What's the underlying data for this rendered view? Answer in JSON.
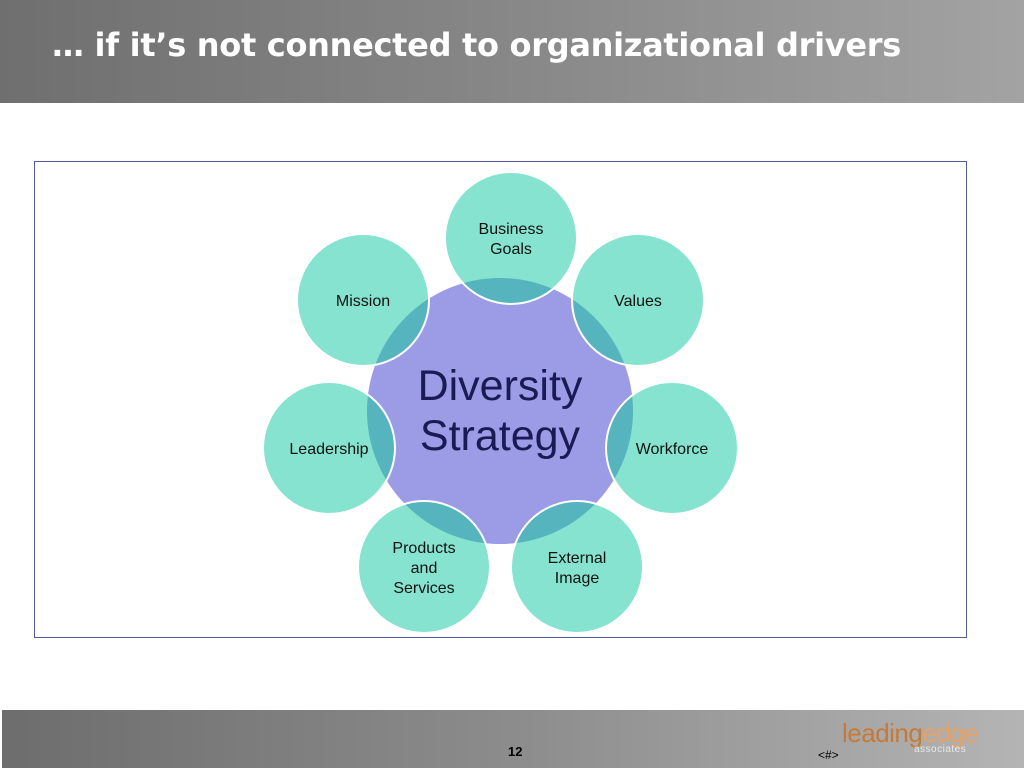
{
  "slide": {
    "title": "… if it’s not connected to organizational drivers",
    "page_number": "12",
    "slide_placeholder": "<#>"
  },
  "diagram": {
    "center_label": [
      "Diversity",
      "Strategy"
    ],
    "nodes": [
      {
        "id": "business-goals",
        "label": [
          "Business",
          "Goals"
        ]
      },
      {
        "id": "values",
        "label": [
          "Values"
        ]
      },
      {
        "id": "workforce",
        "label": [
          "Workforce"
        ]
      },
      {
        "id": "external-image",
        "label": [
          "External",
          "Image"
        ]
      },
      {
        "id": "products-and-services",
        "label": [
          "Products",
          "and",
          "Services"
        ]
      },
      {
        "id": "leadership",
        "label": [
          "Leadership"
        ]
      },
      {
        "id": "mission",
        "label": [
          "Mission"
        ]
      }
    ],
    "colors": {
      "center_fill": "#9b9be6",
      "node_fill": "#85e3cf",
      "overlap_fill": "#55b4bd",
      "node_stroke": "#ffffff",
      "frame_border": "#4f5d9a"
    }
  },
  "logo": {
    "word1": "leading",
    "word2": "edge",
    "sub": "associates"
  }
}
